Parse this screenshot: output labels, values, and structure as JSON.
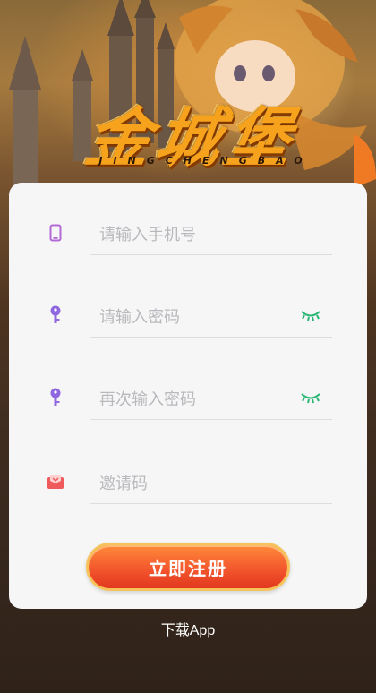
{
  "brand": {
    "logo_text": "金城堡",
    "logo_subtitle": "JINGCHENGBAO"
  },
  "form": {
    "phone": {
      "placeholder": "请输入手机号",
      "icon": "phone-icon",
      "icon_color": "#b36bd6"
    },
    "password": {
      "placeholder": "请输入密码",
      "icon": "key-icon",
      "icon_color": "#8f68e0",
      "toggle_icon": "eye-closed-icon",
      "toggle_color": "#2bb673"
    },
    "confirm_password": {
      "placeholder": "再次输入密码",
      "icon": "key-icon",
      "icon_color": "#8f68e0",
      "toggle_icon": "eye-closed-icon",
      "toggle_color": "#2bb673"
    },
    "invite_code": {
      "placeholder": "邀请码",
      "icon": "envelope-icon",
      "icon_color": "#ef5a5a"
    },
    "submit_label": "立即注册"
  },
  "footer": {
    "download_label": "下载App"
  }
}
